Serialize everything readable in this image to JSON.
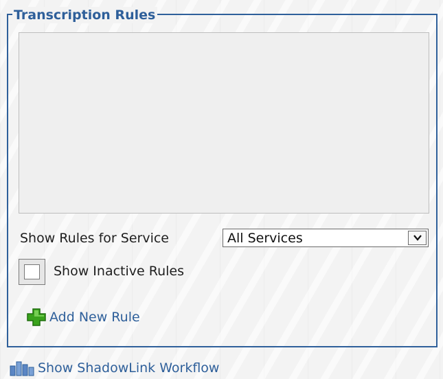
{
  "panel": {
    "title": "Transcription Rules"
  },
  "filters": {
    "service_label": "Show Rules for Service",
    "service_selected": "All Services",
    "inactive_label": "Show Inactive Rules",
    "inactive_checked": false
  },
  "actions": {
    "add_rule_label": "Add New Rule",
    "workflow_label": "Show ShadowLink Workflow"
  },
  "icons": {
    "add": "plus-icon",
    "workflow": "workflow-bars-icon",
    "dropdown": "chevron-down-icon"
  },
  "colors": {
    "accent": "#2e5f9a",
    "add_icon_green": "#3aa31c"
  }
}
